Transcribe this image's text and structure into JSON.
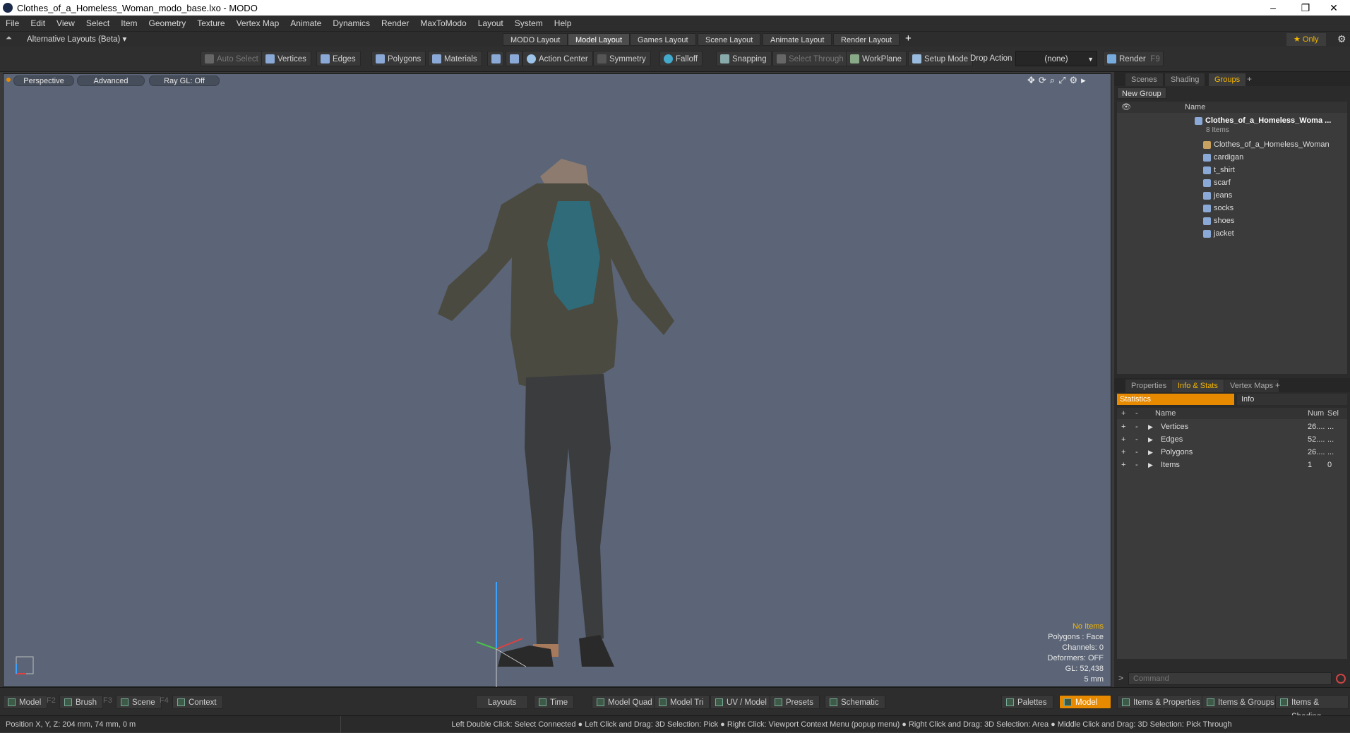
{
  "window": {
    "title": "Clothes_of_a_Homeless_Woman_modo_base.lxo - MODO",
    "minimize": "–",
    "restore": "❐",
    "close": "✕"
  },
  "menu": [
    "File",
    "Edit",
    "View",
    "Select",
    "Item",
    "Geometry",
    "Texture",
    "Vertex Map",
    "Animate",
    "Dynamics",
    "Render",
    "MaxToModo",
    "Layout",
    "System",
    "Help"
  ],
  "layouts": {
    "dropdown": "Alternative Layouts (Beta) ▾",
    "tabs": [
      "MODO Layout",
      "Model Layout",
      "Games Layout",
      "Scene Layout",
      "Animate Layout",
      "Render Layout"
    ],
    "add": "+",
    "only": "★  Only"
  },
  "toolbar": {
    "auto_select": "Auto Select",
    "vertices": "Vertices",
    "edges": "Edges",
    "polygons": "Polygons",
    "materials": "Materials",
    "action_center": "Action Center",
    "symmetry": "Symmetry",
    "falloff": "Falloff",
    "snapping": "Snapping",
    "select_through": "Select Through",
    "workplane": "WorkPlane",
    "setup_mode": "Setup Mode",
    "drop_action": "Drop Action",
    "drop_value": "(none)",
    "render": "Render",
    "render_key": "F9"
  },
  "viewport": {
    "perspective": "Perspective",
    "advanced": "Advanced",
    "raygl": "Ray GL: Off",
    "info": {
      "items": "No Items",
      "polygons": "Polygons : Face",
      "channels": "Channels: 0",
      "deformers": "Deformers: OFF",
      "gl": "GL: 52,438",
      "unit": "5 mm"
    }
  },
  "scene_panel": {
    "tabs": [
      "Scenes",
      "Shading",
      "Groups"
    ],
    "add": "+",
    "new_group": "New Group",
    "name_col": "Name",
    "root": "Clothes_of_a_Homeless_Woma ...",
    "root_count": "8 Items",
    "items": [
      "Clothes_of_a_Homeless_Woman",
      "cardigan",
      "t_shirt",
      "scarf",
      "jeans",
      "socks",
      "shoes",
      "jacket"
    ]
  },
  "props_panel": {
    "tabs": [
      "Properties",
      "Info & Stats",
      "Vertex Maps"
    ],
    "add": "+",
    "statistics": "Statistics",
    "info": "Info",
    "cols": {
      "name": "Name",
      "num": "Num",
      "sel": "Sel"
    },
    "rows": [
      {
        "name": "Vertices",
        "num": "26....",
        "sel": "..."
      },
      {
        "name": "Edges",
        "num": "52....",
        "sel": "..."
      },
      {
        "name": "Polygons",
        "num": "26....",
        "sel": "..."
      },
      {
        "name": "Items",
        "num": "1",
        "sel": "0"
      }
    ]
  },
  "command": {
    "placeholder": "Command",
    "prompt": ">"
  },
  "bottom": {
    "model": "Model",
    "f2": "F2",
    "brush": "Brush",
    "f3": "F3",
    "scene": "Scene",
    "f4": "F4",
    "context": "Context",
    "layouts": "Layouts",
    "time": "Time",
    "model_quad": "Model Quad",
    "model_tri": "Model Tri",
    "uv_model": "UV / Model",
    "presets": "Presets",
    "schematic": "Schematic",
    "palettes": "Palettes",
    "model_active": "Model",
    "items_props": "Items & Properties",
    "items_groups": "Items & Groups",
    "items_shading": "Items & Shading"
  },
  "status": {
    "position": "Position X, Y, Z:   204 mm, 74 mm, 0 m",
    "hint": "Left Double Click: Select Connected ● Left Click and Drag: 3D Selection: Pick ● Right Click: Viewport Context Menu (popup menu) ● Right Click and Drag: 3D Selection: Area ● Middle Click and Drag: 3D Selection: Pick Through"
  }
}
